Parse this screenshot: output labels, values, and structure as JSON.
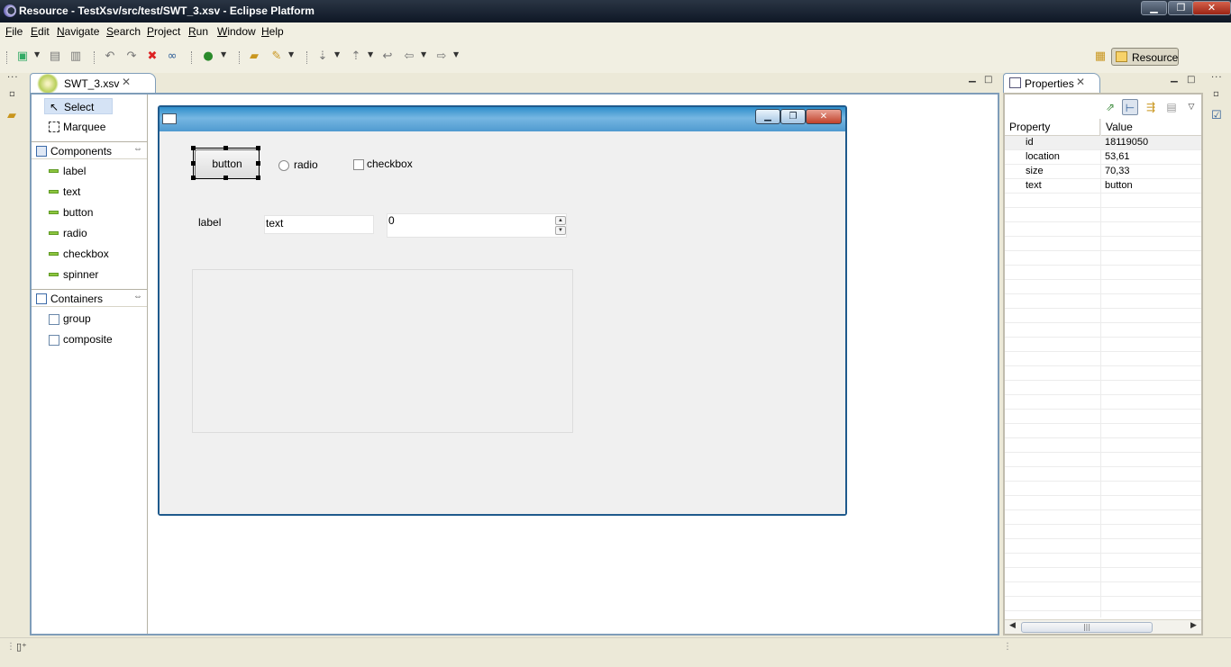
{
  "window": {
    "title": "Resource - TestXsv/src/test/SWT_3.xsv - Eclipse Platform",
    "minimize_glyph": "▁",
    "maximize_glyph": "❐",
    "close_glyph": "✕"
  },
  "menu": {
    "items": [
      "File",
      "Edit",
      "Navigate",
      "Search",
      "Project",
      "Run",
      "Window",
      "Help"
    ]
  },
  "toolbar": {
    "perspective_label": "Resource"
  },
  "editor": {
    "tab_label": "SWT_3.xsv",
    "tab_close": "✕"
  },
  "palette": {
    "tools": [
      {
        "label": "Select",
        "icon": "arrow-pointer-icon",
        "selected": true
      },
      {
        "label": "Marquee",
        "icon": "marquee-icon",
        "selected": false
      }
    ],
    "components_drawer": {
      "label": "Components",
      "items": [
        "label",
        "text",
        "button",
        "radio",
        "checkbox",
        "spinner"
      ]
    },
    "containers_drawer": {
      "label": "Containers",
      "items": [
        "group",
        "composite"
      ]
    },
    "collapse_glyph": "⇔"
  },
  "design": {
    "button_text": "button",
    "radio_text": "radio",
    "checkbox_text": "checkbox",
    "label_text": "label",
    "text_value": "text",
    "spinner_value": "0"
  },
  "properties": {
    "tab_label": "Properties",
    "tab_close": "✕",
    "columns": [
      "Property",
      "Value"
    ],
    "rows": [
      {
        "key": "id",
        "value": "18119050"
      },
      {
        "key": "location",
        "value": "53,61"
      },
      {
        "key": "size",
        "value": "70,33"
      },
      {
        "key": "text",
        "value": "button"
      }
    ]
  }
}
